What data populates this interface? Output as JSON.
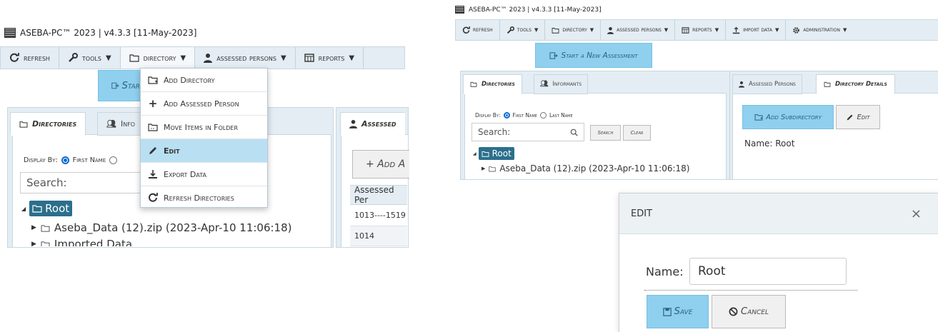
{
  "app_title": "ASEBA-PC™ 2023 | v4.3.3 [11-May-2023]",
  "toolbar": {
    "refresh": "Refresh",
    "tools": "Tools",
    "directory": "Directory",
    "assessed_persons": "Assessed Persons",
    "reports": "Reports",
    "import_data": "Import Data",
    "administration": "Administration"
  },
  "directory_menu": {
    "items": [
      {
        "label": "Add Directory",
        "icon": "add-folder-icon"
      },
      {
        "label": "Add Assessed Person",
        "icon": "plus-icon"
      },
      {
        "label": "Move Items in Folder",
        "icon": "move-folder-icon"
      },
      {
        "label": "Edit",
        "icon": "pencil-icon",
        "highlighted": true
      },
      {
        "label": "Export Data",
        "icon": "export-icon"
      },
      {
        "label": "Refresh Directories",
        "icon": "refresh-icon"
      }
    ]
  },
  "start_assessment_label": "Start a New Assessment",
  "start_assessment_partial": "Star",
  "tabs": {
    "directories": "Directories",
    "informants": "Informants",
    "informants_partial": "Info",
    "assessed_persons": "Assessed Persons",
    "assessed_partial": "Assessed",
    "directory_details": "Directory Details"
  },
  "display_by": {
    "label": "Display By:",
    "first_name": "First Name",
    "last_name": "Last Name",
    "selected": "First Name"
  },
  "search": {
    "placeholder": "Search:",
    "search_button": "Search",
    "clear_button": "Clear"
  },
  "tree": {
    "root": "Root",
    "children": [
      "Aseba_Data (12).zip (2023-Apr-10 11:06:18)",
      "Imported Data"
    ]
  },
  "assessed_table": {
    "add_button": "+ Add A",
    "header": "Assessed Per",
    "rows": [
      "1013----1519",
      "1014"
    ]
  },
  "directory_details": {
    "add_subdirectory": "Add Subdirectory",
    "edit": "Edit",
    "name_line": "Name: Root"
  },
  "edit_dialog": {
    "title": "EDIT",
    "close": "×",
    "name_label": "Name:",
    "name_value": "Root",
    "save": "Save",
    "cancel": "Cancel"
  },
  "colors": {
    "toolbar_bg": "#e3edf3",
    "accent_blue": "#8fd0ef",
    "tree_root_bg": "#2b6f8c",
    "menu_highlight": "#b8dff2"
  }
}
